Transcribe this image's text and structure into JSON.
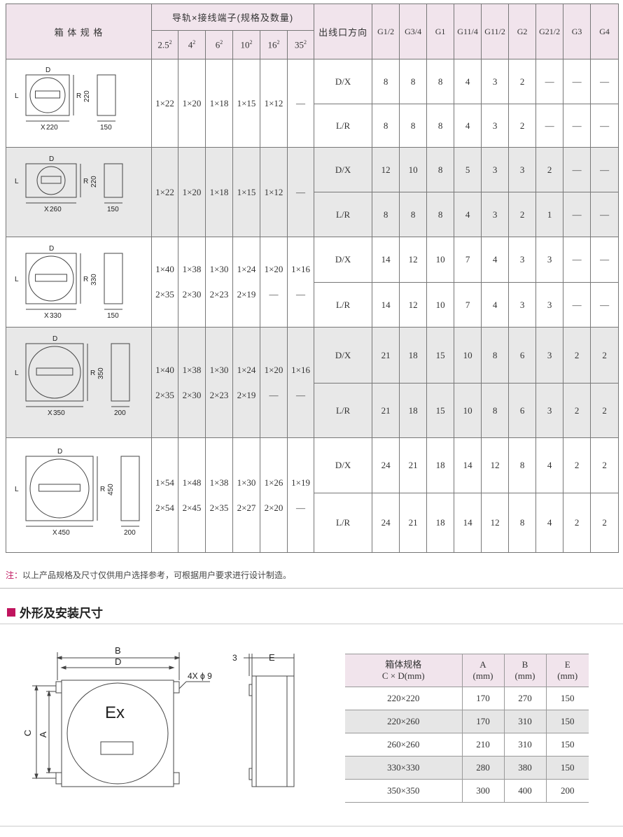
{
  "main_table": {
    "box_spec_header": "箱 体 规 格",
    "terminal_header": "导轨×接线端子(规格及数量)",
    "wire_sizes": [
      {
        "base": "2.5",
        "sup": "2"
      },
      {
        "base": "4",
        "sup": "2"
      },
      {
        "base": "6",
        "sup": "2"
      },
      {
        "base": "10",
        "sup": "2"
      },
      {
        "base": "16",
        "sup": "2"
      },
      {
        "base": "35",
        "sup": "2"
      }
    ],
    "outlet_header": "出线口方向",
    "thread_cols": [
      "G1/2",
      "G3/4",
      "G1",
      "G11/4",
      "G11/2",
      "G2",
      "G21/2",
      "G3",
      "G4"
    ],
    "rows": [
      {
        "dims": {
          "d": "D",
          "l": "L",
          "r": "R",
          "x": "X",
          "w": "220",
          "h": "220",
          "depth": "150"
        },
        "terminals": [
          [
            "1×22"
          ],
          [
            "1×20"
          ],
          [
            "1×18"
          ],
          [
            "1×15"
          ],
          [
            "1×12"
          ],
          [
            "—"
          ]
        ],
        "outlets": [
          {
            "dir": "D/X",
            "values": [
              "8",
              "8",
              "8",
              "4",
              "3",
              "2",
              "—",
              "—",
              "—"
            ]
          },
          {
            "dir": "L/R",
            "values": [
              "8",
              "8",
              "8",
              "4",
              "3",
              "2",
              "—",
              "—",
              "—"
            ]
          }
        ]
      },
      {
        "dims": {
          "d": "D",
          "l": "L",
          "r": "R",
          "x": "X",
          "w": "260",
          "h": "220",
          "depth": "150"
        },
        "terminals": [
          [
            "1×22"
          ],
          [
            "1×20"
          ],
          [
            "1×18"
          ],
          [
            "1×15"
          ],
          [
            "1×12"
          ],
          [
            "—"
          ]
        ],
        "outlets": [
          {
            "dir": "D/X",
            "values": [
              "12",
              "10",
              "8",
              "5",
              "3",
              "3",
              "2",
              "—",
              "—"
            ]
          },
          {
            "dir": "L/R",
            "values": [
              "8",
              "8",
              "8",
              "4",
              "3",
              "2",
              "1",
              "—",
              "—"
            ]
          }
        ]
      },
      {
        "dims": {
          "d": "D",
          "l": "L",
          "r": "R",
          "x": "X",
          "w": "330",
          "h": "330",
          "depth": "150"
        },
        "terminals": [
          [
            "1×40",
            "2×35"
          ],
          [
            "1×38",
            "2×30"
          ],
          [
            "1×30",
            "2×23"
          ],
          [
            "1×24",
            "2×19"
          ],
          [
            "1×20",
            "—"
          ],
          [
            "1×16",
            "—"
          ]
        ],
        "outlets": [
          {
            "dir": "D/X",
            "values": [
              "14",
              "12",
              "10",
              "7",
              "4",
              "3",
              "3",
              "—",
              "—"
            ]
          },
          {
            "dir": "L/R",
            "values": [
              "14",
              "12",
              "10",
              "7",
              "4",
              "3",
              "3",
              "—",
              "—"
            ]
          }
        ]
      },
      {
        "dims": {
          "d": "D",
          "l": "L",
          "r": "R",
          "x": "X",
          "w": "350",
          "h": "350",
          "depth": "200"
        },
        "terminals": [
          [
            "1×40",
            "2×35"
          ],
          [
            "1×38",
            "2×30"
          ],
          [
            "1×30",
            "2×23"
          ],
          [
            "1×24",
            "2×19"
          ],
          [
            "1×20",
            "—"
          ],
          [
            "1×16",
            "—"
          ]
        ],
        "outlets": [
          {
            "dir": "D/X",
            "values": [
              "21",
              "18",
              "15",
              "10",
              "8",
              "6",
              "3",
              "2",
              "2"
            ]
          },
          {
            "dir": "L/R",
            "values": [
              "21",
              "18",
              "15",
              "10",
              "8",
              "6",
              "3",
              "2",
              "2"
            ]
          }
        ]
      },
      {
        "dims": {
          "d": "D",
          "l": "L",
          "r": "R",
          "x": "X",
          "w": "450",
          "h": "450",
          "depth": "200"
        },
        "terminals": [
          [
            "1×54",
            "2×54"
          ],
          [
            "1×48",
            "2×45"
          ],
          [
            "1×38",
            "2×35"
          ],
          [
            "1×30",
            "2×27"
          ],
          [
            "1×26",
            "2×20"
          ],
          [
            "1×19",
            "—"
          ]
        ],
        "outlets": [
          {
            "dir": "D/X",
            "values": [
              "24",
              "21",
              "18",
              "14",
              "12",
              "8",
              "4",
              "2",
              "2"
            ]
          },
          {
            "dir": "L/R",
            "values": [
              "24",
              "21",
              "18",
              "14",
              "12",
              "8",
              "4",
              "2",
              "2"
            ]
          }
        ]
      }
    ]
  },
  "note": {
    "prefix": "注：",
    "text": "以上产品规格及尺寸仅供用户选择参考，可根据用户要求进行设计制造。"
  },
  "section_title": "外形及安装尺寸",
  "drawing": {
    "b": "B",
    "d": "D",
    "c": "C",
    "a": "A",
    "e": "E",
    "three": "3",
    "holes": "4X ϕ 9",
    "ex": "Ex"
  },
  "dim_table": {
    "headers": [
      {
        "l1": "箱体规格",
        "l2": "C × D(mm)"
      },
      {
        "l1": "A",
        "l2": "(mm)"
      },
      {
        "l1": "B",
        "l2": "(mm)"
      },
      {
        "l1": "E",
        "l2": "(mm)"
      }
    ],
    "rows": [
      [
        "220×220",
        "170",
        "270",
        "150"
      ],
      [
        "220×260",
        "170",
        "310",
        "150"
      ],
      [
        "260×260",
        "210",
        "310",
        "150"
      ],
      [
        "330×330",
        "280",
        "380",
        "150"
      ],
      [
        "350×350",
        "300",
        "400",
        "200"
      ]
    ]
  },
  "colors": {
    "accent": "#c0145e",
    "header_bg": "#f1e4ec",
    "row_gray": "#e8e8e8"
  }
}
